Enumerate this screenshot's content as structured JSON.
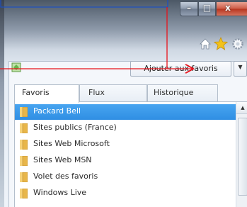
{
  "window": {
    "caption": {
      "minimize_glyph": "–",
      "maximize_glyph": "□",
      "close_glyph": "x"
    },
    "toolbar_icons": [
      "home-icon",
      "favorites-star-icon",
      "tools-gear-icon"
    ]
  },
  "favorites_panel": {
    "add_button_label": "Ajouter aux favoris",
    "dropdown_glyph": "▼",
    "tabs": [
      {
        "label": "Favoris",
        "selected": true
      },
      {
        "label": "Flux",
        "selected": false
      },
      {
        "label": "Historique",
        "selected": false
      }
    ],
    "items": [
      {
        "label": "Packard Bell",
        "selected": true,
        "icon": "folder-icon"
      },
      {
        "label": "Sites publics (France)",
        "selected": false,
        "icon": "folder-icon"
      },
      {
        "label": "Sites Web Microsoft",
        "selected": false,
        "icon": "folder-icon"
      },
      {
        "label": "Sites Web MSN",
        "selected": false,
        "icon": "folder-icon"
      },
      {
        "label": "Volet des favoris",
        "selected": false,
        "icon": "folder-icon"
      },
      {
        "label": "Windows Live",
        "selected": false,
        "icon": "folder-icon"
      }
    ],
    "scrollbar_up_glyph": "▲"
  },
  "annotation": {
    "color": "#e8131b"
  },
  "colors": {
    "selection": "#3a99ea",
    "close_button": "#c8452f",
    "folder": "#e8b64a"
  }
}
